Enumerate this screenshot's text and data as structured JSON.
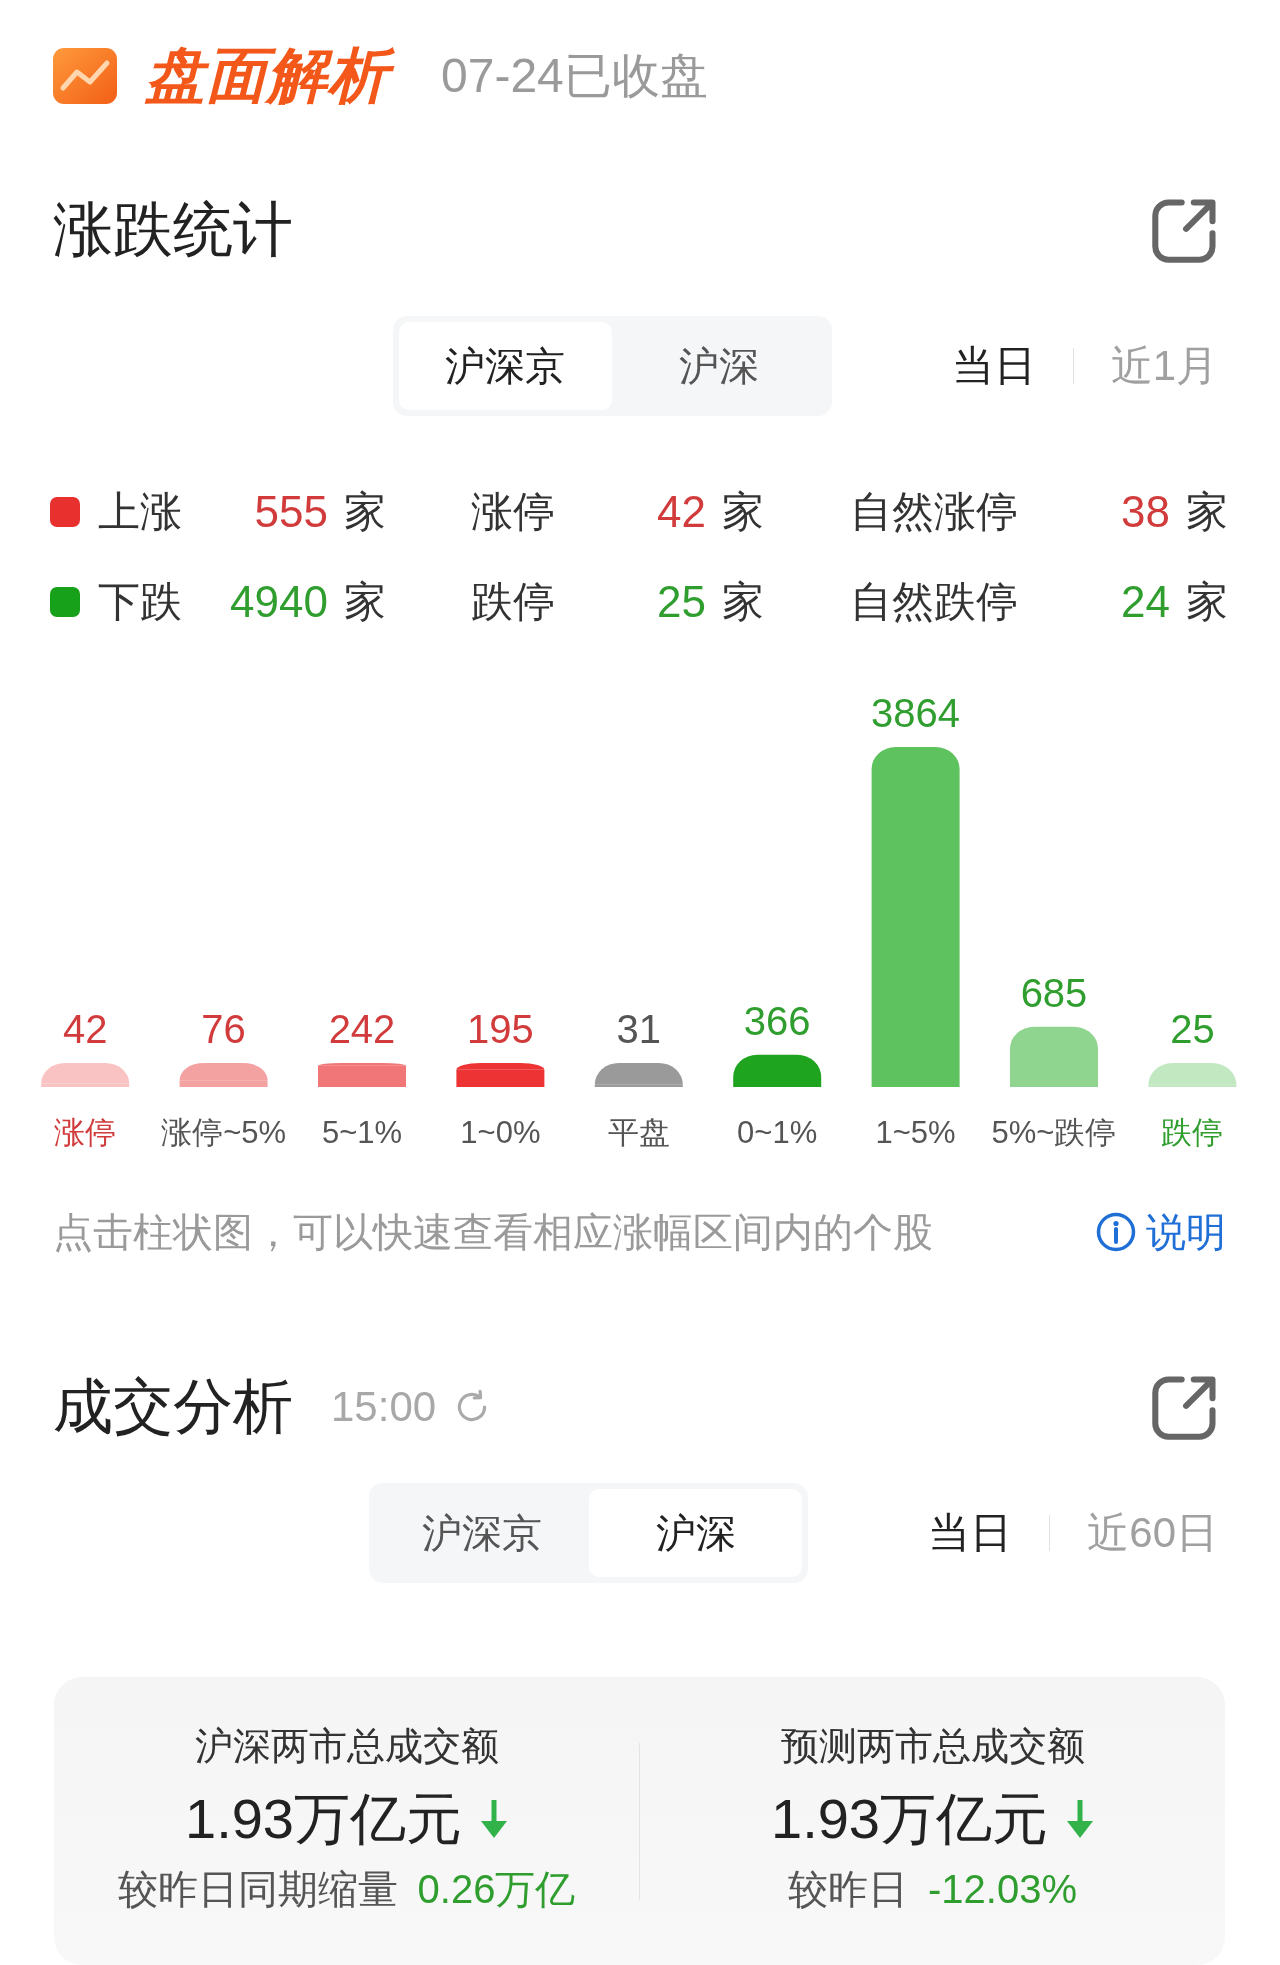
{
  "header": {
    "title": "盘面解析",
    "status": "07-24已收盘"
  },
  "rise_fall": {
    "title": "涨跌统计",
    "market_tabs": [
      {
        "label": "沪深京",
        "selected": true
      },
      {
        "label": "沪深",
        "selected": false
      }
    ],
    "period_tabs": [
      {
        "label": "当日",
        "selected": true
      },
      {
        "label": "近1月",
        "selected": false
      }
    ],
    "stats": [
      {
        "kind": "up",
        "color": "#e8302f",
        "items": [
          {
            "label": "上涨",
            "count": "555",
            "unit": "家"
          },
          {
            "label": "涨停",
            "count": "42",
            "unit": "家"
          },
          {
            "label": "自然涨停",
            "count": "38",
            "unit": "家"
          }
        ]
      },
      {
        "kind": "down",
        "color": "#17a01a",
        "items": [
          {
            "label": "下跌",
            "count": "4940",
            "unit": "家"
          },
          {
            "label": "跌停",
            "count": "25",
            "unit": "家"
          },
          {
            "label": "自然跌停",
            "count": "24",
            "unit": "家"
          }
        ]
      }
    ],
    "chart": {
      "chart_data": {
        "type": "bar",
        "categories": [
          "涨停",
          "涨停~5%",
          "5~1%",
          "1~0%",
          "平盘",
          "0~1%",
          "1~5%",
          "5%~跌停",
          "跌停"
        ],
        "series": [
          {
            "values": [
              42,
              76,
              242,
              195,
              31,
              366,
              3864,
              685,
              25
            ]
          }
        ],
        "data_labels": true
      },
      "bars": [
        {
          "kind": "up",
          "color": "#f9c3c4",
          "accent": true
        },
        {
          "kind": "up",
          "color": "#f4a1a2",
          "accent": false
        },
        {
          "kind": "up",
          "color": "#f17677",
          "accent": false
        },
        {
          "kind": "up",
          "color": "#ee3335",
          "accent": false
        },
        {
          "kind": "flat",
          "color": "#9a9a9a",
          "accent": false
        },
        {
          "kind": "down",
          "color": "#1fa41f",
          "accent": false
        },
        {
          "kind": "down",
          "color": "#5ec35e",
          "accent": false
        },
        {
          "kind": "down",
          "color": "#8fd48f",
          "accent": false
        },
        {
          "kind": "down",
          "color": "#c2e8c2",
          "accent": true
        }
      ]
    },
    "hint": "点击柱状图，可以快速查看相应涨幅区间内的个股",
    "help_link": "说明"
  },
  "turnover": {
    "title": "成交分析",
    "time": "15:00",
    "market_tabs": [
      {
        "label": "沪深京",
        "selected": false
      },
      {
        "label": "沪深",
        "selected": true
      }
    ],
    "period_tabs": [
      {
        "label": "当日",
        "selected": true
      },
      {
        "label": "近60日",
        "selected": false
      }
    ],
    "summary": [
      {
        "title": "沪深两市总成交额",
        "amount": "1.93万亿元",
        "kind": "down",
        "compare_label": "较昨日同期缩量",
        "compare_value": "0.26万亿"
      },
      {
        "title": "预测两市总成交额",
        "amount": "1.93万亿元",
        "kind": "down",
        "compare_label": "较昨日",
        "compare_value": "-12.03%"
      }
    ]
  }
}
